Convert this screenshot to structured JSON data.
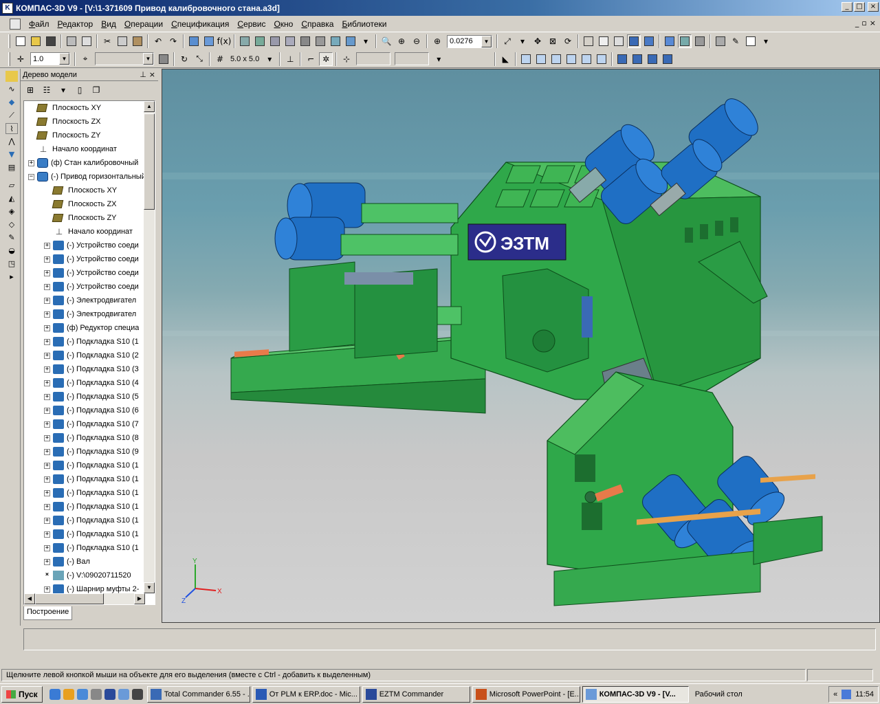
{
  "window": {
    "title": "КОМПАС-3D V9 - [V:\\1-371609 Привод калибровочного стана.a3d]",
    "minimize": "_",
    "maximize": "□",
    "close": "×"
  },
  "menu": {
    "items": [
      "Файл",
      "Редактор",
      "Вид",
      "Операции",
      "Спецификация",
      "Сервис",
      "Окно",
      "Справка",
      "Библиотеки"
    ],
    "mdi_min": "_",
    "mdi_restore": "▫",
    "mdi_close": "×"
  },
  "toolbar": {
    "zoom_value": "0.0276",
    "line_width": "1.0",
    "grid_size": "5.0 x 5.0"
  },
  "tree": {
    "title": "Дерево модели",
    "pin": "⊥",
    "close": "×",
    "tab": "Построение",
    "items": [
      {
        "label": "Плоскость XY",
        "icon": "plane",
        "indent": 0,
        "expander": ""
      },
      {
        "label": "Плоскость ZX",
        "icon": "plane",
        "indent": 0,
        "expander": ""
      },
      {
        "label": "Плоскость ZY",
        "icon": "plane",
        "indent": 0,
        "expander": ""
      },
      {
        "label": "Начало координат",
        "icon": "origin",
        "indent": 0,
        "expander": ""
      },
      {
        "label": "(ф) Стан калибровочный",
        "icon": "assembly",
        "indent": 0,
        "expander": "+"
      },
      {
        "label": "(-) Привод горизонтальный",
        "icon": "assembly",
        "indent": 0,
        "expander": "−"
      },
      {
        "label": "Плоскость XY",
        "icon": "plane",
        "indent": 1,
        "expander": ""
      },
      {
        "label": "Плоскость ZX",
        "icon": "plane",
        "indent": 1,
        "expander": ""
      },
      {
        "label": "Плоскость ZY",
        "icon": "plane",
        "indent": 1,
        "expander": ""
      },
      {
        "label": "Начало координат",
        "icon": "origin",
        "indent": 1,
        "expander": ""
      },
      {
        "label": "(-) Устройство соеди",
        "icon": "part",
        "indent": 1,
        "expander": "+"
      },
      {
        "label": "(-) Устройство соеди",
        "icon": "part",
        "indent": 1,
        "expander": "+"
      },
      {
        "label": "(-) Устройство соеди",
        "icon": "part",
        "indent": 1,
        "expander": "+"
      },
      {
        "label": "(-) Устройство соеди",
        "icon": "part",
        "indent": 1,
        "expander": "+"
      },
      {
        "label": "(-) Электродвигател",
        "icon": "part",
        "indent": 1,
        "expander": "+"
      },
      {
        "label": "(-) Электродвигател",
        "icon": "part",
        "indent": 1,
        "expander": "+"
      },
      {
        "label": "(ф) Редуктор специа",
        "icon": "part",
        "indent": 1,
        "expander": "+"
      },
      {
        "label": "(-) Подкладка S10 (1",
        "icon": "part",
        "indent": 1,
        "expander": "+"
      },
      {
        "label": "(-) Подкладка S10 (2",
        "icon": "part",
        "indent": 1,
        "expander": "+"
      },
      {
        "label": "(-) Подкладка S10 (3",
        "icon": "part",
        "indent": 1,
        "expander": "+"
      },
      {
        "label": "(-) Подкладка S10 (4",
        "icon": "part",
        "indent": 1,
        "expander": "+"
      },
      {
        "label": "(-) Подкладка S10 (5",
        "icon": "part",
        "indent": 1,
        "expander": "+"
      },
      {
        "label": "(-) Подкладка S10 (6",
        "icon": "part",
        "indent": 1,
        "expander": "+"
      },
      {
        "label": "(-) Подкладка S10 (7",
        "icon": "part",
        "indent": 1,
        "expander": "+"
      },
      {
        "label": "(-) Подкладка S10 (8",
        "icon": "part",
        "indent": 1,
        "expander": "+"
      },
      {
        "label": "(-) Подкладка S10 (9",
        "icon": "part",
        "indent": 1,
        "expander": "+"
      },
      {
        "label": "(-) Подкладка S10 (1",
        "icon": "part",
        "indent": 1,
        "expander": "+"
      },
      {
        "label": "(-) Подкладка S10 (1",
        "icon": "part",
        "indent": 1,
        "expander": "+"
      },
      {
        "label": "(-) Подкладка S10 (1",
        "icon": "part",
        "indent": 1,
        "expander": "+"
      },
      {
        "label": "(-) Подкладка S10 (1",
        "icon": "part",
        "indent": 1,
        "expander": "+"
      },
      {
        "label": "(-) Подкладка S10 (1",
        "icon": "part",
        "indent": 1,
        "expander": "+"
      },
      {
        "label": "(-) Подкладка S10 (1",
        "icon": "part",
        "indent": 1,
        "expander": "+"
      },
      {
        "label": "(-) Подкладка S10 (1",
        "icon": "part",
        "indent": 1,
        "expander": "+"
      },
      {
        "label": "(-) Вал",
        "icon": "part",
        "indent": 1,
        "expander": "+"
      },
      {
        "label": "(-) V:\\09020711520",
        "icon": "sheet",
        "indent": 1,
        "expander": "×"
      },
      {
        "label": "(-) Шарнир муфты 2-",
        "icon": "part",
        "indent": 1,
        "expander": "+"
      }
    ]
  },
  "viewport": {
    "logo_text": "ЭЗТМ",
    "axis_x": "X",
    "axis_y": "Y",
    "axis_z": "Z"
  },
  "status": {
    "message": "Щелкните левой кнопкой мыши на объекте для его выделения (вместе с Ctrl - добавить к выделенным)"
  },
  "taskbar": {
    "start": "Пуск",
    "tasks": [
      {
        "label": "Total Commander 6.55 - ...",
        "active": false
      },
      {
        "label": "От PLM к ERP.doc - Mic...",
        "active": false
      },
      {
        "label": "EZTM Commander",
        "active": false
      },
      {
        "label": "Microsoft PowerPoint - [E...",
        "active": false
      },
      {
        "label": "КОМПАС-3D V9 - [V...",
        "active": true
      }
    ],
    "desktop": "Рабочий стол",
    "chevron": "«",
    "clock": "11:54"
  },
  "colors": {
    "machine_green": "#2fa84a",
    "motor_blue": "#1f6fc4",
    "logo_bg": "#2b2d8a"
  }
}
